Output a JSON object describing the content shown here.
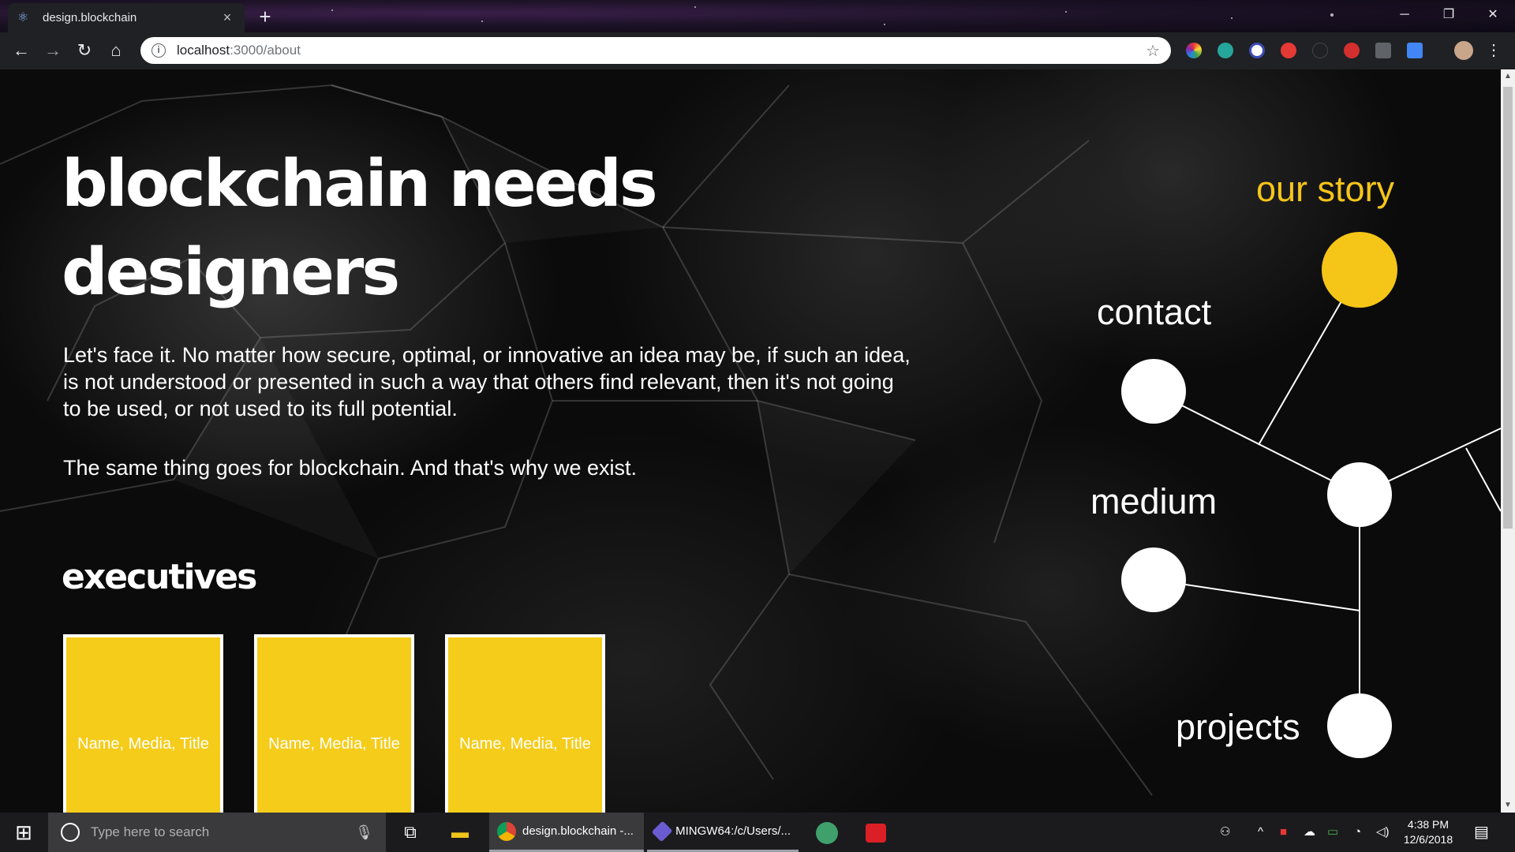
{
  "browser": {
    "tab_title": "design.blockchain",
    "tab_close": "×",
    "new_tab": "+",
    "url_host": "localhost",
    "url_path": ":3000/about",
    "window_min": "─",
    "window_restore": "❐",
    "window_close": "✕"
  },
  "page": {
    "headline_line1": "blockchain needs",
    "headline_line2": "designers",
    "paragraph1": "Let's face it. No matter how secure, optimal, or innovative an idea may be, if such an idea, is not understood or presented in such a way that others find relevant, then it's not going to be used, or not used to its full potential.",
    "paragraph2": "The same thing goes for blockchain. And that's why we exist.",
    "executives_heading": "executives",
    "cards": [
      {
        "label": "Name, Media, Title"
      },
      {
        "label": "Name, Media, Title"
      },
      {
        "label": "Name, Media, Title"
      }
    ]
  },
  "nav_graph": {
    "active_color": "#f5c518",
    "items": [
      {
        "label": "our story",
        "active": true
      },
      {
        "label": "contact",
        "active": false
      },
      {
        "label": "medium",
        "active": false
      },
      {
        "label": "projects",
        "active": false
      }
    ]
  },
  "taskbar": {
    "search_placeholder": "Type here to search",
    "apps": [
      {
        "label": "design.blockchain -..."
      },
      {
        "label": "MINGW64:/c/Users/..."
      }
    ],
    "time": "4:38 PM",
    "date": "12/6/2018"
  },
  "colors": {
    "accent_yellow": "#f5cc1a",
    "chrome_dark": "#202124"
  }
}
